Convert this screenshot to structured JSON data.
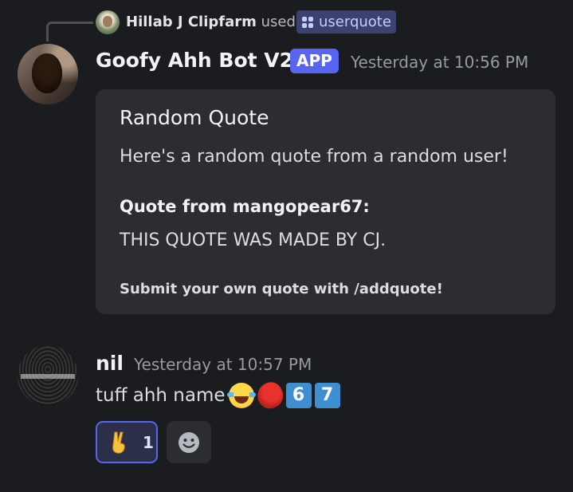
{
  "interaction": {
    "user": "Hillab J Clipfarm",
    "verb": "used",
    "command": "userquote"
  },
  "bot_message": {
    "author": "Goofy Ahh Bot V2",
    "badge": "APP",
    "timestamp": "Yesterday at 10:56 PM",
    "embed": {
      "title": "Random Quote",
      "description": "Here's a random quote from a random user!",
      "field_name": "Quote from mangopear67:",
      "field_value": "THIS QUOTE WAS MADE BY CJ.",
      "footer": "Submit your own quote with /addquote!"
    }
  },
  "user_message": {
    "author": "nil",
    "timestamp": "Yesterday at 10:57 PM",
    "text": "tuff ahh name",
    "emojis": [
      "joy-emoji",
      "mango-emoji"
    ],
    "keycaps": [
      "6",
      "7"
    ]
  },
  "reactions": [
    {
      "emoji": "victory-hand-emoji",
      "count": "1",
      "selected": true
    }
  ],
  "colors": {
    "background": "#1b1c20",
    "embed_background": "#2b2d31",
    "app_badge": "#5865f2",
    "command_chip": "#3c4270",
    "timestamp": "#949ba4"
  }
}
